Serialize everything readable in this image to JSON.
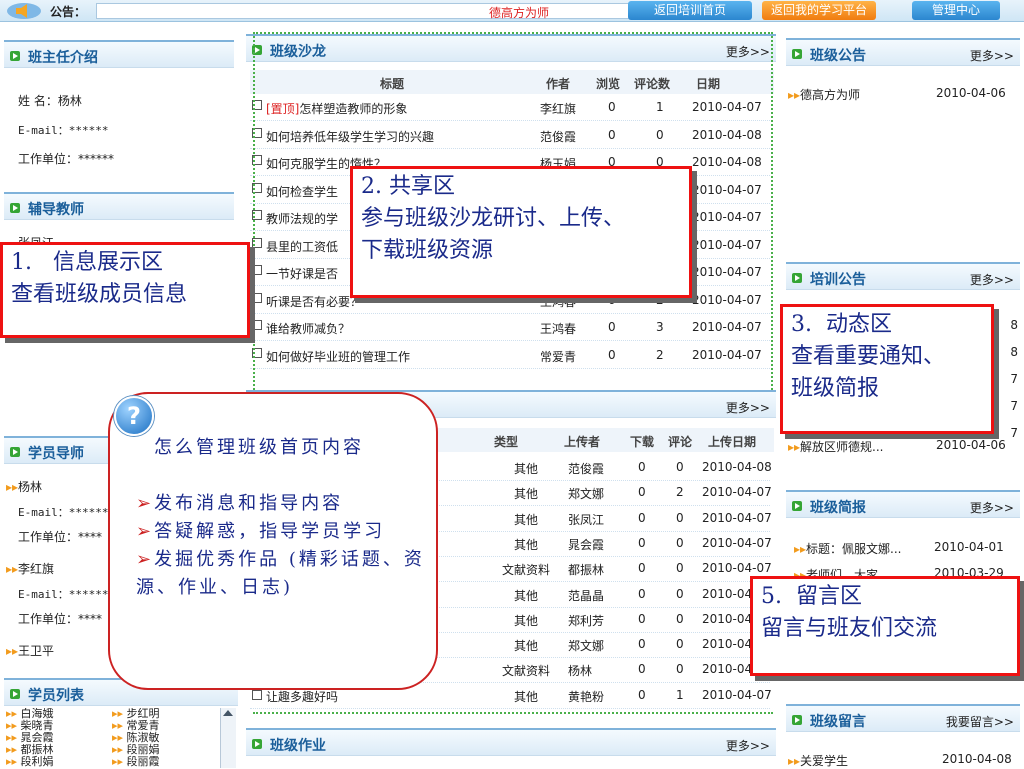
{
  "topbar": {
    "notice_label": "公告：",
    "marquee_text": "德高方为师",
    "btn_home": "返回培训首页",
    "btn_my": "返回我的学习平台",
    "btn_admin": "管理中心"
  },
  "left": {
    "teacher_title": "班主任介绍",
    "teacher": {
      "name_label": "姓    名：",
      "name_value": "杨林",
      "email_label": "E-mail：",
      "email_value": "******",
      "unit_label": "工作单位：",
      "unit_value": "******"
    },
    "tutor_title": "辅导教师",
    "tutor_partial": "张凤江",
    "mentor_title": "学员导师",
    "mentors": [
      {
        "name": "杨林",
        "email": "E-mail：******",
        "unit": "工作单位：****"
      },
      {
        "name": "李红旗",
        "email": "E-mail：******",
        "unit": "工作单位：****"
      },
      {
        "name": "王卫平"
      }
    ],
    "list_title": "学员列表",
    "students_col1": [
      "白海娥",
      "柴晓青",
      "晁会霞",
      "都振林",
      "段利娟"
    ],
    "students_col2": [
      "步红明",
      "常爱青",
      "陈淑敏",
      "段丽娟",
      "段丽霞"
    ]
  },
  "salon": {
    "title": "班级沙龙",
    "more": "更多>>",
    "headers": [
      "标题",
      "作者",
      "浏览",
      "评论数",
      "日期"
    ],
    "rows": [
      {
        "tag": "[置顶]",
        "title": "怎样塑造教师的形象",
        "author": "李红旗",
        "views": "0",
        "comments": "1",
        "date": "2010-04-07"
      },
      {
        "title": "如何培养低年级学生学习的兴趣",
        "author": "范俊霞",
        "views": "0",
        "comments": "0",
        "date": "2010-04-08"
      },
      {
        "title": "如何克服学生的惰性？",
        "author": "杨玉娟",
        "views": "0",
        "comments": "0",
        "date": "2010-04-08"
      },
      {
        "title": "如何检查学生",
        "author": "",
        "views": "",
        "comments": "",
        "date": "2010-04-07"
      },
      {
        "title": "教师法规的学",
        "author": "",
        "views": "",
        "comments": "",
        "date": "2010-04-07"
      },
      {
        "title": "县里的工资低",
        "author": "",
        "views": "",
        "comments": "",
        "date": "2010-04-07"
      },
      {
        "title": "一节好课是否",
        "author": "",
        "views": "",
        "comments": "",
        "date": "2010-04-07"
      },
      {
        "title": "听课是否有必要？",
        "author": "王鸿春",
        "views": "0",
        "comments": "2",
        "date": "2010-04-07"
      },
      {
        "title": "谁给教师减负？",
        "author": "王鸿春",
        "views": "0",
        "comments": "3",
        "date": "2010-04-07"
      },
      {
        "title": "如何做好毕业班的管理工作",
        "author": "常爱青",
        "views": "0",
        "comments": "2",
        "date": "2010-04-07"
      }
    ]
  },
  "resources": {
    "more": "更多>>",
    "headers": [
      "类型",
      "上传者",
      "下载",
      "评论",
      "上传日期"
    ],
    "rows": [
      {
        "type": "其他",
        "uploader": "范俊霞",
        "dl": "0",
        "cm": "0",
        "date": "2010-04-08"
      },
      {
        "type": "其他",
        "uploader": "郑文娜",
        "dl": "0",
        "cm": "2",
        "date": "2010-04-07"
      },
      {
        "type": "其他",
        "uploader": "张凤江",
        "dl": "0",
        "cm": "0",
        "date": "2010-04-07"
      },
      {
        "type": "其他",
        "uploader": "晁会霞",
        "dl": "0",
        "cm": "0",
        "date": "2010-04-07"
      },
      {
        "type": "文献资料",
        "uploader": "都振林",
        "dl": "0",
        "cm": "0",
        "date": "2010-04-07"
      },
      {
        "type": "其他",
        "uploader": "范晶晶",
        "dl": "0",
        "cm": "0",
        "date": "2010-04"
      },
      {
        "type": "其他",
        "uploader": "郑利芳",
        "dl": "0",
        "cm": "0",
        "date": "2010-04"
      },
      {
        "type": "其他",
        "uploader": "郑文娜",
        "dl": "0",
        "cm": "0",
        "date": "2010-04"
      },
      {
        "type": "文献资料",
        "uploader": "杨林",
        "dl": "0",
        "cm": "0",
        "date": "2010-04"
      },
      {
        "title": "让趣多趣好吗",
        "type": "其他",
        "uploader": "黄艳粉",
        "dl": "0",
        "cm": "1",
        "date": "2010-04-07"
      }
    ]
  },
  "homework": {
    "title": "班级作业",
    "more": "更多>>"
  },
  "right": {
    "announce_title": "班级公告",
    "announce_more": "更多>>",
    "announce_item": "德高方为师",
    "announce_date": "2010-04-06",
    "training_title": "培训公告",
    "training_more": "更多>>",
    "training_dates": [
      "8",
      "8",
      "7",
      "7",
      "7"
    ],
    "training_item": "解放区师德规...",
    "training_date": "2010-04-06",
    "brief_title": "班级简报",
    "brief_more": "更多>>",
    "brief_items": [
      {
        "text": "标题：佩服文娜...",
        "date": "2010-04-01"
      },
      {
        "text": "老师们，大家",
        "date": "2010-03-29"
      }
    ],
    "msg_title": "班级留言",
    "msg_more": "我要留言>>",
    "msg_item": "关爱学生",
    "msg_date": "2010-04-08"
  },
  "annotations": {
    "a1_line1": "1.   信息展示区",
    "a1_line2": "查看班级成员信息",
    "a2_line1": "2. 共享区",
    "a2_line2": "参与班级沙龙研讨、上传、",
    "a2_line3": "下载班级资源",
    "a3_line1": "3.  动态区",
    "a3_line2": "查看重要通知、",
    "a3_line3": "班级简报",
    "a5_line1": "5.  留言区",
    "a5_line2": "留言与班友们交流"
  },
  "bubble": {
    "line1": "怎么管理班级首页内容",
    "item1": "发布消息和指导内容",
    "item2": "答疑解惑，指导学员学习",
    "item3": "发掘优秀作品 (精彩话题、资源、作业、日志)"
  }
}
